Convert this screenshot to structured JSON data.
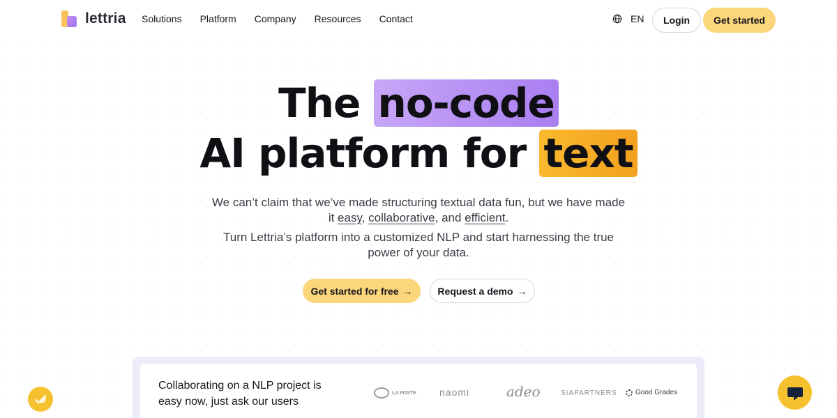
{
  "nav": {
    "logo_text": "lettria",
    "menu": [
      "Solutions",
      "Platform",
      "Company",
      "Resources",
      "Contact"
    ],
    "language": "EN",
    "login": "Login",
    "get_started": "Get started"
  },
  "hero": {
    "line1_a": "The",
    "line1_hl": "no-code",
    "line2_a": "AI platform for",
    "line2_hl": "text",
    "sub1_a": "We can’t claim that we’ve made structuring textual data fun, but we have made",
    "sub1_b": "it",
    "sub1_easy": "easy",
    "sub1_c": ",",
    "sub1_collab": "collaborative",
    "sub1_d": ", and",
    "sub1_eff": "efficient",
    "sub1_e": ".",
    "sub2_a": "Turn Lettria’s platform into a customized NLP and start harnessing the true",
    "sub2_b": "power of your data.",
    "cta_primary": "Get started for free",
    "cta_secondary": "Request a demo",
    "arrow": "→"
  },
  "users": {
    "line1": "Collaborating on a NLP project is",
    "line2": "easy now, just ask our users",
    "partners": [
      "LA POSTE",
      "naomi",
      "adeo",
      "SIAPARTNERS",
      "Good Grades"
    ]
  },
  "colors": {
    "accent_yellow": "#fbd67b",
    "highlight_purple": "#b48af4",
    "highlight_orange": "#f5ab23"
  },
  "icons": {
    "globe": "globe-icon",
    "arrow": "arrow-right-icon",
    "chat": "chat-bubble-icon",
    "badge": "check-lines-icon"
  }
}
